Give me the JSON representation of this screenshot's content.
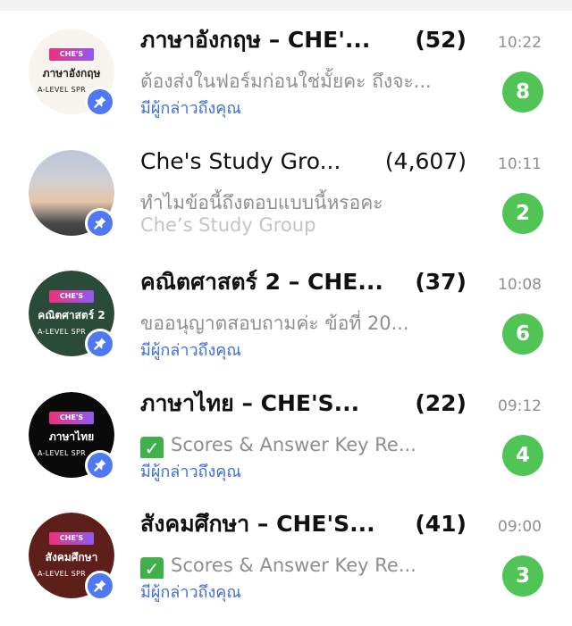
{
  "chats": [
    {
      "name": "ภาษาอังกฤษ – CHE'...",
      "count": "(52)",
      "time": "10:22",
      "preview": "ต้องส่งในฟอร์มก่อนใช่มั้ยคะ ถึงจะ...",
      "preview_check": false,
      "mention": "มีผู้กล่าวถึงคุณ",
      "mention_style": "mention",
      "unread": "8",
      "avatar": {
        "tag": "CHE'S",
        "title": "ภาษาอังกฤษ",
        "subtitle": "A-LEVEL SPR",
        "bg": "#f7f3ef",
        "fg": "#222222"
      }
    },
    {
      "name": "Che's Study Gro...",
      "count": "(4,607)",
      "time": "10:11",
      "preview": "ทำไมข้อนี้ถึงตอบแบบนี้หรอคะ",
      "preview_check": false,
      "mention": "Che’s Study Group",
      "mention_style": "grey",
      "unread": "2",
      "avatar": {
        "tag": "",
        "title": "",
        "subtitle": "",
        "bg": "photo",
        "fg": "#ffffff"
      }
    },
    {
      "name": "คณิตศาสตร์ 2 – CHE...",
      "count": "(37)",
      "time": "10:08",
      "preview": "ขออนุญาตสอบถามค่ะ ข้อที่ 20...",
      "preview_check": false,
      "mention": "มีผู้กล่าวถึงคุณ",
      "mention_style": "mention",
      "unread": "6",
      "avatar": {
        "tag": "CHE'S",
        "title": "คณิตศาสตร์ 2",
        "subtitle": "A-LEVEL SPR",
        "bg": "#2a4a3a",
        "fg": "#ffffff"
      }
    },
    {
      "name": "ภาษาไทย – CHE'S...",
      "count": "(22)",
      "time": "09:12",
      "preview": "Scores & Answer Key Re...",
      "preview_check": true,
      "mention": "มีผู้กล่าวถึงคุณ",
      "mention_style": "mention",
      "unread": "4",
      "avatar": {
        "tag": "CHE'S",
        "title": "ภาษาไทย",
        "subtitle": "A-LEVEL SPR",
        "bg": "#0a0a0a",
        "fg": "#ffffff"
      }
    },
    {
      "name": "สังคมศึกษา – CHE'S...",
      "count": "(41)",
      "time": "09:00",
      "preview": "Scores & Answer Key Re...",
      "preview_check": true,
      "mention": "มีผู้กล่าวถึงคุณ",
      "mention_style": "mention",
      "unread": "3",
      "avatar": {
        "tag": "CHE'S",
        "title": "สังคมศึกษา",
        "subtitle": "A-LEVEL SPR",
        "bg": "#5e1e1a",
        "fg": "#ffffff"
      }
    }
  ],
  "icons": {
    "pin": "pin-icon",
    "check": "check-mark-icon"
  },
  "colors": {
    "badge": "#51c456",
    "pin": "#4f79f3",
    "mention": "#3f6fd6",
    "muted": "#8e8e93"
  }
}
